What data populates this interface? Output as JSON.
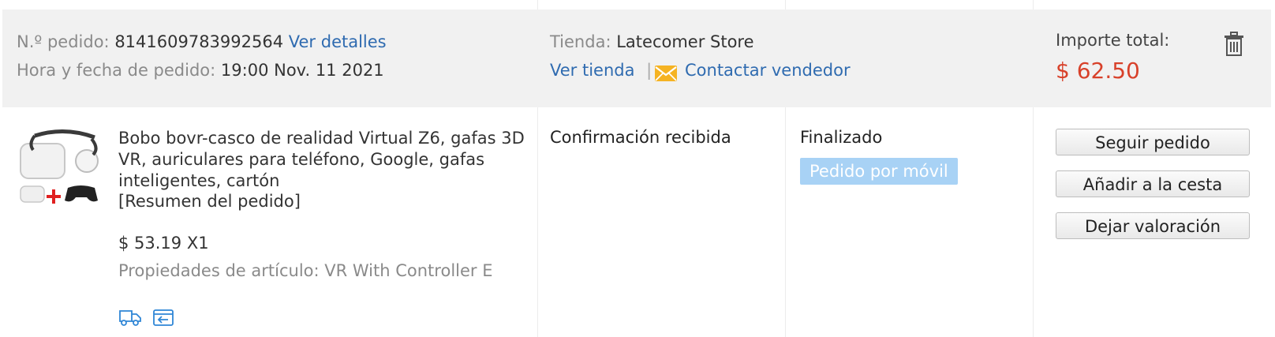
{
  "order_header": {
    "order_no_label": "N.º pedido:",
    "order_no_value": "8141609783992564",
    "details_link": "Ver detalles",
    "datetime_label": "Hora y fecha de pedido:",
    "datetime_value": "19:00 Nov. 11 2021",
    "store_label": "Tienda:",
    "store_name": "Latecomer Store",
    "view_store_link": "Ver tienda",
    "separator": "|",
    "contact_link": "Contactar vendedor",
    "total_label": "Importe total:",
    "total_value": "$ 62.50"
  },
  "item": {
    "title": "Bobo bovr-casco de realidad Virtual Z6, gafas 3D VR, auriculares para teléfono, Google, gafas inteligentes, cartón",
    "summary": "[Resumen del pedido]",
    "price_qty": "$ 53.19 X1",
    "properties": "Propiedades de artículo: VR With Controller E",
    "shipping_status": "Confirmación recibida",
    "order_status": "Finalizado",
    "mobile_badge": "Pedido por móvil"
  },
  "actions": {
    "track": "Seguir pedido",
    "add_to_cart": "Añadir a la cesta",
    "review": "Dejar valoración"
  },
  "icons": [
    "trash-icon",
    "mail-icon",
    "delivery-truck-icon",
    "return-icon"
  ],
  "colors": {
    "link": "#2f6bb0",
    "price": "#d8412a",
    "badge": "#a8d2f5",
    "mail": "#f5b323"
  }
}
